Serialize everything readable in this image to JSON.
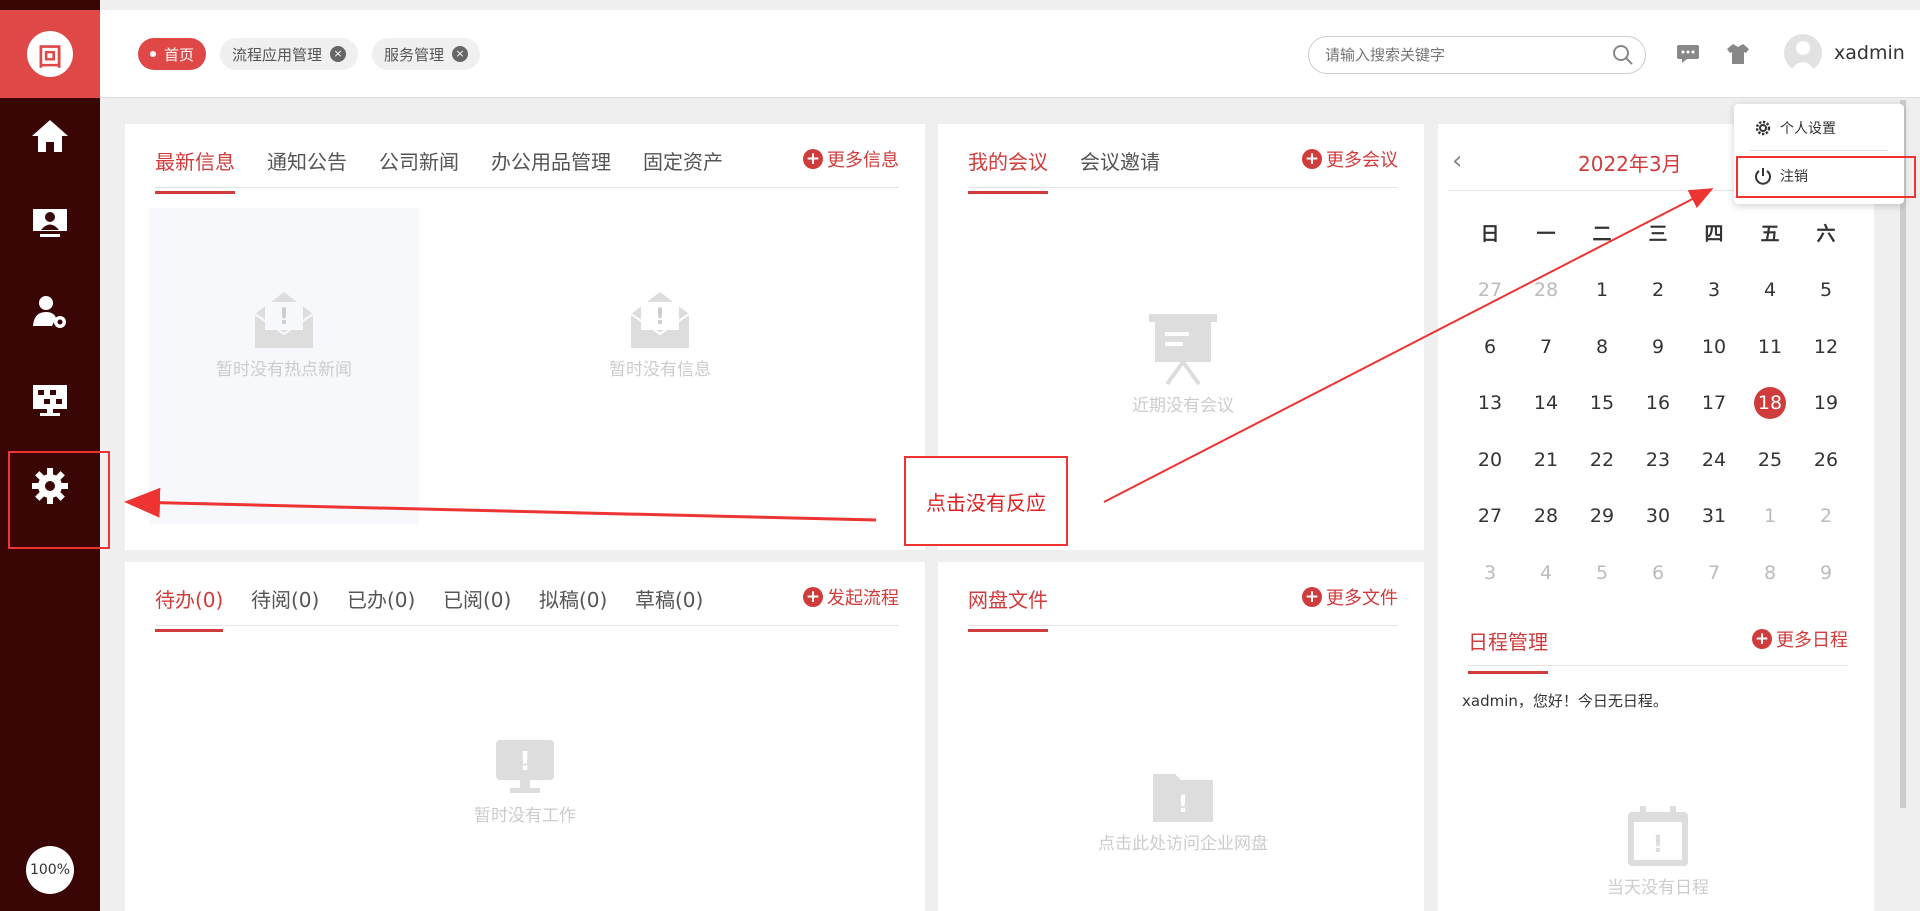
{
  "zoom_level": "100%",
  "tabs": [
    {
      "label": "首页",
      "active": true
    },
    {
      "label": "流程应用管理",
      "active": false
    },
    {
      "label": "服务管理",
      "active": false
    }
  ],
  "search": {
    "placeholder": "请输入搜索关键字"
  },
  "user": {
    "name": "xadmin"
  },
  "news_panel": {
    "tabs": [
      "最新信息",
      "通知公告",
      "公司新闻",
      "办公用品管理",
      "固定资产"
    ],
    "more": "更多信息",
    "empty_hot": "暂时没有热点新闻",
    "empty_info": "暂时没有信息"
  },
  "meeting_panel": {
    "tabs": [
      "我的会议",
      "会议邀请"
    ],
    "more": "更多会议",
    "empty": "近期没有会议"
  },
  "work_panel": {
    "tabs": [
      "待办(0)",
      "待阅(0)",
      "已办(0)",
      "已阅(0)",
      "拟稿(0)",
      "草稿(0)"
    ],
    "more": "发起流程",
    "empty": "暂时没有工作"
  },
  "disk_panel": {
    "tabs": [
      "网盘文件"
    ],
    "more": "更多文件",
    "empty": "点击此处访问企业网盘"
  },
  "calendar": {
    "title": "2022年3月",
    "weekdays": [
      "日",
      "一",
      "二",
      "三",
      "四",
      "五",
      "六"
    ],
    "days": [
      [
        "27",
        "28",
        "1",
        "2",
        "3",
        "4",
        "5"
      ],
      [
        "6",
        "7",
        "8",
        "9",
        "10",
        "11",
        "12"
      ],
      [
        "13",
        "14",
        "15",
        "16",
        "17",
        "18",
        "19"
      ],
      [
        "20",
        "21",
        "22",
        "23",
        "24",
        "25",
        "26"
      ],
      [
        "27",
        "28",
        "29",
        "30",
        "31",
        "1",
        "2"
      ],
      [
        "3",
        "4",
        "5",
        "6",
        "7",
        "8",
        "9"
      ]
    ],
    "today": "18"
  },
  "schedule": {
    "title": "日程管理",
    "more": "更多日程",
    "greeting": "xadmin，您好！今日无日程。",
    "empty": "当天没有日程"
  },
  "dropdown": {
    "settings": "个人设置",
    "logout": "注销"
  },
  "annotation": {
    "text": "点击没有反应"
  },
  "colors": {
    "accent": "#d03c3c",
    "sidebar": "#3a0505",
    "annotation": "#e33333"
  }
}
